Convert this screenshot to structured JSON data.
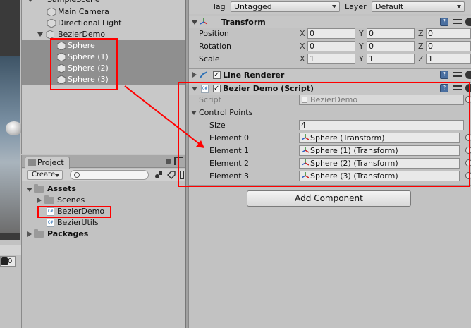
{
  "hierarchy": {
    "scene_name": "SampleScene*",
    "items": [
      {
        "label": "Main Camera",
        "selected": false
      },
      {
        "label": "Directional Light",
        "selected": false
      },
      {
        "label": "BezierDemo",
        "selected": false
      },
      {
        "label": "Sphere",
        "selected": true
      },
      {
        "label": "Sphere (1)",
        "selected": true
      },
      {
        "label": "Sphere (2)",
        "selected": true
      },
      {
        "label": "Sphere (3)",
        "selected": true
      }
    ]
  },
  "project": {
    "tab_label": "Project",
    "create_label": "Create",
    "tree": [
      {
        "label": "Assets",
        "bold": true
      },
      {
        "label": "Scenes",
        "bold": false
      },
      {
        "label": "BezierDemo",
        "bold": false
      },
      {
        "label": "BezierUtils",
        "bold": false
      },
      {
        "label": "Packages",
        "bold": true
      }
    ]
  },
  "scene_view": {
    "counter": "0"
  },
  "inspector": {
    "tag_label": "Tag",
    "tag_value": "Untagged",
    "layer_label": "Layer",
    "layer_value": "Default",
    "transform": {
      "title": "Transform",
      "rows": [
        {
          "label": "Position",
          "x": "0",
          "y": "0",
          "z": "0"
        },
        {
          "label": "Rotation",
          "x": "0",
          "y": "0",
          "z": "0"
        },
        {
          "label": "Scale",
          "x": "1",
          "y": "1",
          "z": "1"
        }
      ],
      "axis_x": "X",
      "axis_y": "Y",
      "axis_z": "Z"
    },
    "line_renderer": {
      "title": "Line Renderer"
    },
    "bezier_demo": {
      "title": "Bezier Demo (Script)",
      "script_label": "Script",
      "script_value": "BezierDemo",
      "control_points_label": "Control Points",
      "size_label": "Size",
      "size_value": "4",
      "elements": [
        {
          "label": "Element 0",
          "value": "Sphere (Transform)"
        },
        {
          "label": "Element 1",
          "value": "Sphere (1) (Transform)"
        },
        {
          "label": "Element 2",
          "value": "Sphere (2) (Transform)"
        },
        {
          "label": "Element 3",
          "value": "Sphere (3) (Transform)"
        }
      ]
    },
    "add_component_label": "Add Component"
  },
  "colors": {
    "annotation_red": "#ff0000",
    "selection_gray": "#8f8f8f",
    "panel_bg": "#c2c2c2"
  }
}
